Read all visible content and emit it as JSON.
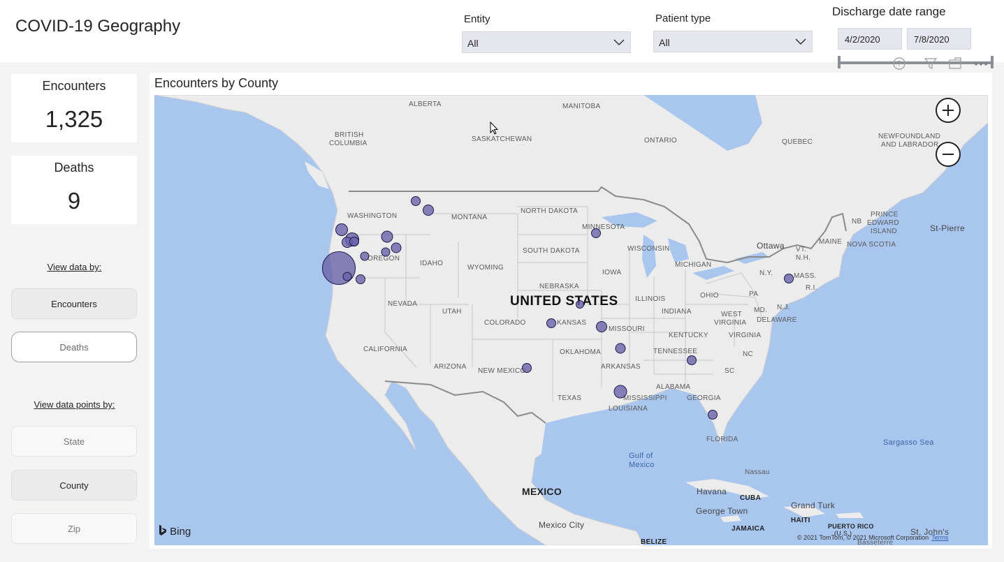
{
  "header": {
    "title": "COVID-19 Geography",
    "entity": {
      "label": "Entity",
      "value": "All"
    },
    "patient_type": {
      "label": "Patient type",
      "value": "All"
    },
    "discharge": {
      "label": "Discharge date range",
      "start": "4/2/2020",
      "end": "7/8/2020"
    }
  },
  "kpis": {
    "encounters": {
      "label": "Encounters",
      "value": "1,325"
    },
    "deaths": {
      "label": "Deaths",
      "value": "9"
    }
  },
  "view_data_by": {
    "label": "View data by:",
    "options": [
      "Encounters",
      "Deaths"
    ],
    "selected": "Encounters"
  },
  "view_points_by": {
    "label": "View data points by:",
    "options": [
      "State",
      "County",
      "Zip"
    ],
    "selected": "County"
  },
  "map": {
    "title": "Encounters by County",
    "provider": "Bing",
    "copyright": "© 2021 TomTom, © 2021 Microsoft Corporation",
    "terms": "Terms",
    "labels": {
      "alberta": "ALBERTA",
      "manitoba": "MANITOBA",
      "bc1": "BRITISH",
      "bc2": "COLUMBIA",
      "saskatchewan": "SASKATCHEWAN",
      "ontario": "ONTARIO",
      "quebec": "QUEBEC",
      "nl1": "NEWFOUNDLAND",
      "nl2": "AND LABRADOR",
      "washington": "WASHINGTON",
      "montana": "MONTANA",
      "north_dakota": "NORTH DAKOTA",
      "minnesota": "MINNESOTA",
      "pei1": "PRINCE",
      "pei2": "EDWARD",
      "pei3": "ISLAND",
      "nb": "NB",
      "st_pierre": "St-Pierre",
      "maine": "MAINE",
      "nova_scotia": "NOVA SCOTIA",
      "ottawa": "Ottawa",
      "vt": "VT.",
      "nh": "N.H.",
      "south_dakota": "SOUTH DAKOTA",
      "wisconsin": "WISCONSIN",
      "oregon": "OREGON",
      "idaho": "IDAHO",
      "wyoming": "WYOMING",
      "michigan": "MICHIGAN",
      "ny": "N.Y.",
      "mass": "MASS.",
      "ri": "R.I.",
      "iowa": "IOWA",
      "nebraska": "NEBRASKA",
      "nevada": "NEVADA",
      "utah": "UTAH",
      "us": "UNITED STATES",
      "illinois": "ILLINOIS",
      "ohio": "OHIO",
      "pa": "PA",
      "nj": "N.J.",
      "indiana": "INDIANA",
      "md": "MD.",
      "delaware": "DELAWARE",
      "colorado": "COLORADO",
      "kansas": "KANSAS",
      "missouri": "MISSOURI",
      "wv1": "WEST",
      "wv2": "VIRGINIA",
      "kentucky": "KENTUCKY",
      "virginia": "VIRGINIA",
      "california": "CALIFORNIA",
      "oklahoma": "OKLAHOMA",
      "tennessee": "TENNESSEE",
      "nc": "NC",
      "arizona": "ARIZONA",
      "new_mexico": "NEW MEXICO",
      "arkansas": "ARKANSAS",
      "sc": "SC",
      "alabama": "ALABAMA",
      "texas": "TEXAS",
      "mississippi": "MISSISSIPPI",
      "georgia": "GEORGIA",
      "louisiana": "LOUISIANA",
      "florida": "FLORIDA",
      "sargasso": "Sargasso Sea",
      "gulf1": "Gulf of",
      "gulf2": "Mexico",
      "nassau": "Nassau",
      "mexico": "MEXICO",
      "havana": "Havana",
      "cuba": "CUBA",
      "grand_turk": "Grand Turk",
      "george_town": "George Town",
      "haiti": "HAITI",
      "jamaica": "JAMAICA",
      "pr1": "PUERTO RICO",
      "pr2": "(U.S.)",
      "mexico_city": "Mexico City",
      "st_johns": "St. John's",
      "basseterre": "Basseterre",
      "belize": "BELIZE"
    }
  },
  "colors": {
    "bubble": "#6860a8",
    "bubble_border": "#1e1a4a",
    "water": "#a9c6ee",
    "land": "#ececec"
  },
  "icons": [
    "chevron-down-icon",
    "help-icon",
    "filter-icon",
    "focus-mode-icon",
    "more-options-icon",
    "zoom-in-icon",
    "zoom-out-icon",
    "bing-logo-icon",
    "cursor-icon"
  ]
}
